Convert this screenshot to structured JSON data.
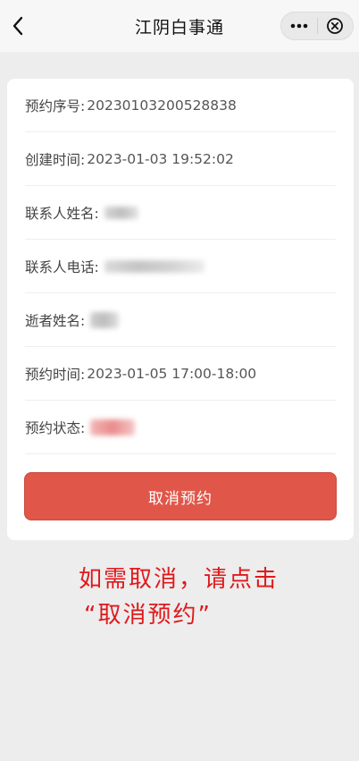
{
  "nav": {
    "title": "江阴白事通",
    "more_icon": "more-dots-icon",
    "close_icon": "close-circle-icon",
    "back_icon": "chevron-left-icon"
  },
  "details": [
    {
      "label": "预约序号:",
      "value": "20230103200528838"
    },
    {
      "label": "创建时间:",
      "value": "2023-01-03 19:52:02"
    },
    {
      "label": "联系人姓名:",
      "value": ""
    },
    {
      "label": "联系人电话:",
      "value": ""
    },
    {
      "label": "逝者姓名:",
      "value": ""
    },
    {
      "label": "预约时间:",
      "value": "2023-01-05 17:00-18:00"
    },
    {
      "label": "预约状态:",
      "value": ""
    }
  ],
  "cancel_button": "取消预约",
  "annotation": {
    "line1": "如需取消，请点击",
    "line2": "“取消预约”"
  },
  "colors": {
    "accent": "#e0574a",
    "annotation": "#e0191c"
  }
}
